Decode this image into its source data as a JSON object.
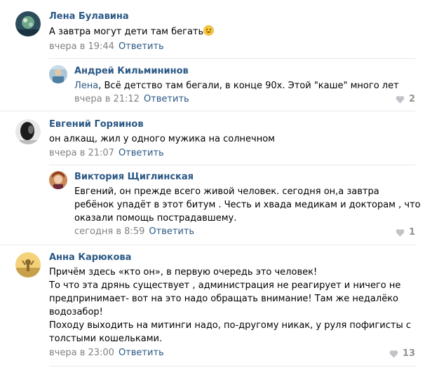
{
  "comments": [
    {
      "author": "Лена Булавина",
      "text_lines": [
        "А завтра могут дети там бегать"
      ],
      "time": "вчера в 19:44",
      "reply": "Ответить",
      "emoji": "grinning-sweat-emoji"
    },
    {
      "author": "Андрей Кильмининов",
      "mention": "Лена",
      "text_lines": [
        ", Всё детство там бегали, в конце 90х. Этой \"каше\" много лет"
      ],
      "time": "вчера в 21:12",
      "reply": "Ответить",
      "likes": "2"
    },
    {
      "author": "Евгений Горяинов",
      "text_lines": [
        "он алкащ, жил у одного мужика на солнечном"
      ],
      "time": "вчера в 21:07",
      "reply": "Ответить"
    },
    {
      "author": "Виктория Щиглинская",
      "text_lines": [
        "Евгений, он прежде всего живой человек. сегодня он,а завтра",
        "ребёнок упадёт в этот битум . Честь и хвада медикам и докторам , что",
        "оказали помощь пострадавшему."
      ],
      "time": "сегодня в 8:59",
      "reply": "Ответить",
      "likes": "1"
    },
    {
      "author": "Анна Карюкова",
      "text_lines": [
        "Причём здесь «кто он», в первую очередь это человек!",
        "То что эта дрянь существует , администрация не реагирует и ничего не",
        "предпринимает- вот на это надо обращать внимание! Там же недалёко",
        "водозабор!",
        "Походу выходить на митинги надо, по-другому никак, у руля пофигисты с",
        "толстыми кошельками."
      ],
      "time": "вчера в 23:00",
      "reply": "Ответить",
      "likes": "13"
    }
  ],
  "icons": {
    "like": "heart-icon"
  },
  "colors": {
    "link": "#2a5885",
    "meta": "#828282",
    "divider": "#e7e8ec"
  }
}
